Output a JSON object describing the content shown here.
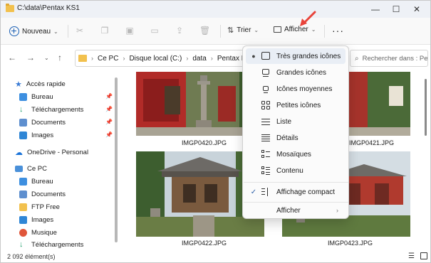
{
  "window": {
    "title": "C:\\data\\Pentax KS1",
    "controls": [
      "—",
      "☐",
      "✕"
    ]
  },
  "toolbar": {
    "new_label": "Nouveau",
    "sort_label": "Trier",
    "view_label": "Afficher",
    "more_label": "···"
  },
  "address": {
    "crumbs": [
      "Ce PC",
      "Disque local (C:)",
      "data",
      "Pentax KS1"
    ],
    "search_placeholder": "Rechercher dans : Pe..."
  },
  "sidebar": {
    "quick_access": "Accès rapide",
    "quick_items": [
      "Bureau",
      "Téléchargements",
      "Documents",
      "Images"
    ],
    "onedrive": "OneDrive - Personal",
    "this_pc": "Ce PC",
    "pc_items": [
      "Bureau",
      "Documents",
      "FTP Free",
      "Images",
      "Musique",
      "Téléchargements"
    ]
  },
  "content": {
    "files": [
      "IMGP0420.JPG",
      "IMGP0421.JPG",
      "IMGP0422.JPG",
      "IMGP0423.JPG"
    ]
  },
  "status": {
    "count": "2 092 élément(s)"
  },
  "view_menu": {
    "items": [
      {
        "label": "Très grandes icônes",
        "icon": "extra-large-icons-icon",
        "checked": true
      },
      {
        "label": "Grandes icônes",
        "icon": "large-icons-icon",
        "checked": false
      },
      {
        "label": "Icônes moyennes",
        "icon": "medium-icons-icon",
        "checked": false
      },
      {
        "label": "Petites icônes",
        "icon": "small-icons-icon",
        "checked": false
      },
      {
        "label": "Liste",
        "icon": "list-icon",
        "checked": false
      },
      {
        "label": "Détails",
        "icon": "details-icon",
        "checked": false
      },
      {
        "label": "Mosaïques",
        "icon": "tiles-icon",
        "checked": false
      },
      {
        "label": "Contenu",
        "icon": "content-icon",
        "checked": false
      }
    ],
    "compact": {
      "label": "Affichage compact",
      "checked": true
    },
    "show": {
      "label": "Afficher"
    }
  },
  "colors": {
    "accent": "#1a5fb4",
    "annotation_arrow": "#e8433a",
    "folder": "#f2c14e"
  }
}
